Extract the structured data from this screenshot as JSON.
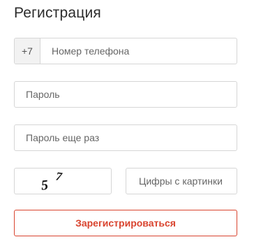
{
  "form": {
    "title": "Регистрация",
    "phone": {
      "prefix": "+7",
      "placeholder": "Номер телефона",
      "value": ""
    },
    "password": {
      "placeholder": "Пароль",
      "value": ""
    },
    "password_repeat": {
      "placeholder": "Пароль еще раз",
      "value": ""
    },
    "captcha": {
      "image_digits": [
        "5",
        "7"
      ],
      "placeholder": "Цифры с картинки",
      "value": ""
    },
    "submit_label": "Зарегистрироваться"
  },
  "colors": {
    "accent": "#d9442f",
    "border": "#d6d6d6",
    "prefix_bg": "#f2f2f2"
  }
}
